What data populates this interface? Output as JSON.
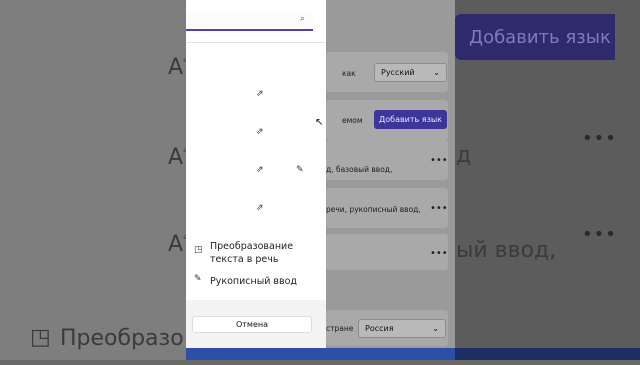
{
  "dialog": {
    "search": {
      "placeholder": "",
      "value": ""
    },
    "options": [
      {
        "label": "Преобразование текста в речь",
        "icon": "speech-icon"
      },
      {
        "label": "Рукописный ввод",
        "icon": "handwriting-icon"
      }
    ],
    "cancel_label": "Отмена"
  },
  "settings": {
    "row1_text": "как",
    "row1_select": "Русский",
    "row2_text": "емом",
    "add_language_label": "Добавить язык",
    "row3_text": "д, базовый ввод,",
    "row4_text": "речи, рукописный ввод,",
    "row5_text": "стране",
    "row5_select": "Россия"
  },
  "background": {
    "add_language_label": "Добавить язык",
    "basic_input_fragment": "д",
    "handwriting_fragment": "ый ввод,",
    "tts_fragment": "Преобразо"
  },
  "colors": {
    "accent": "#4b43b2",
    "primary_button": "#3c359a"
  }
}
